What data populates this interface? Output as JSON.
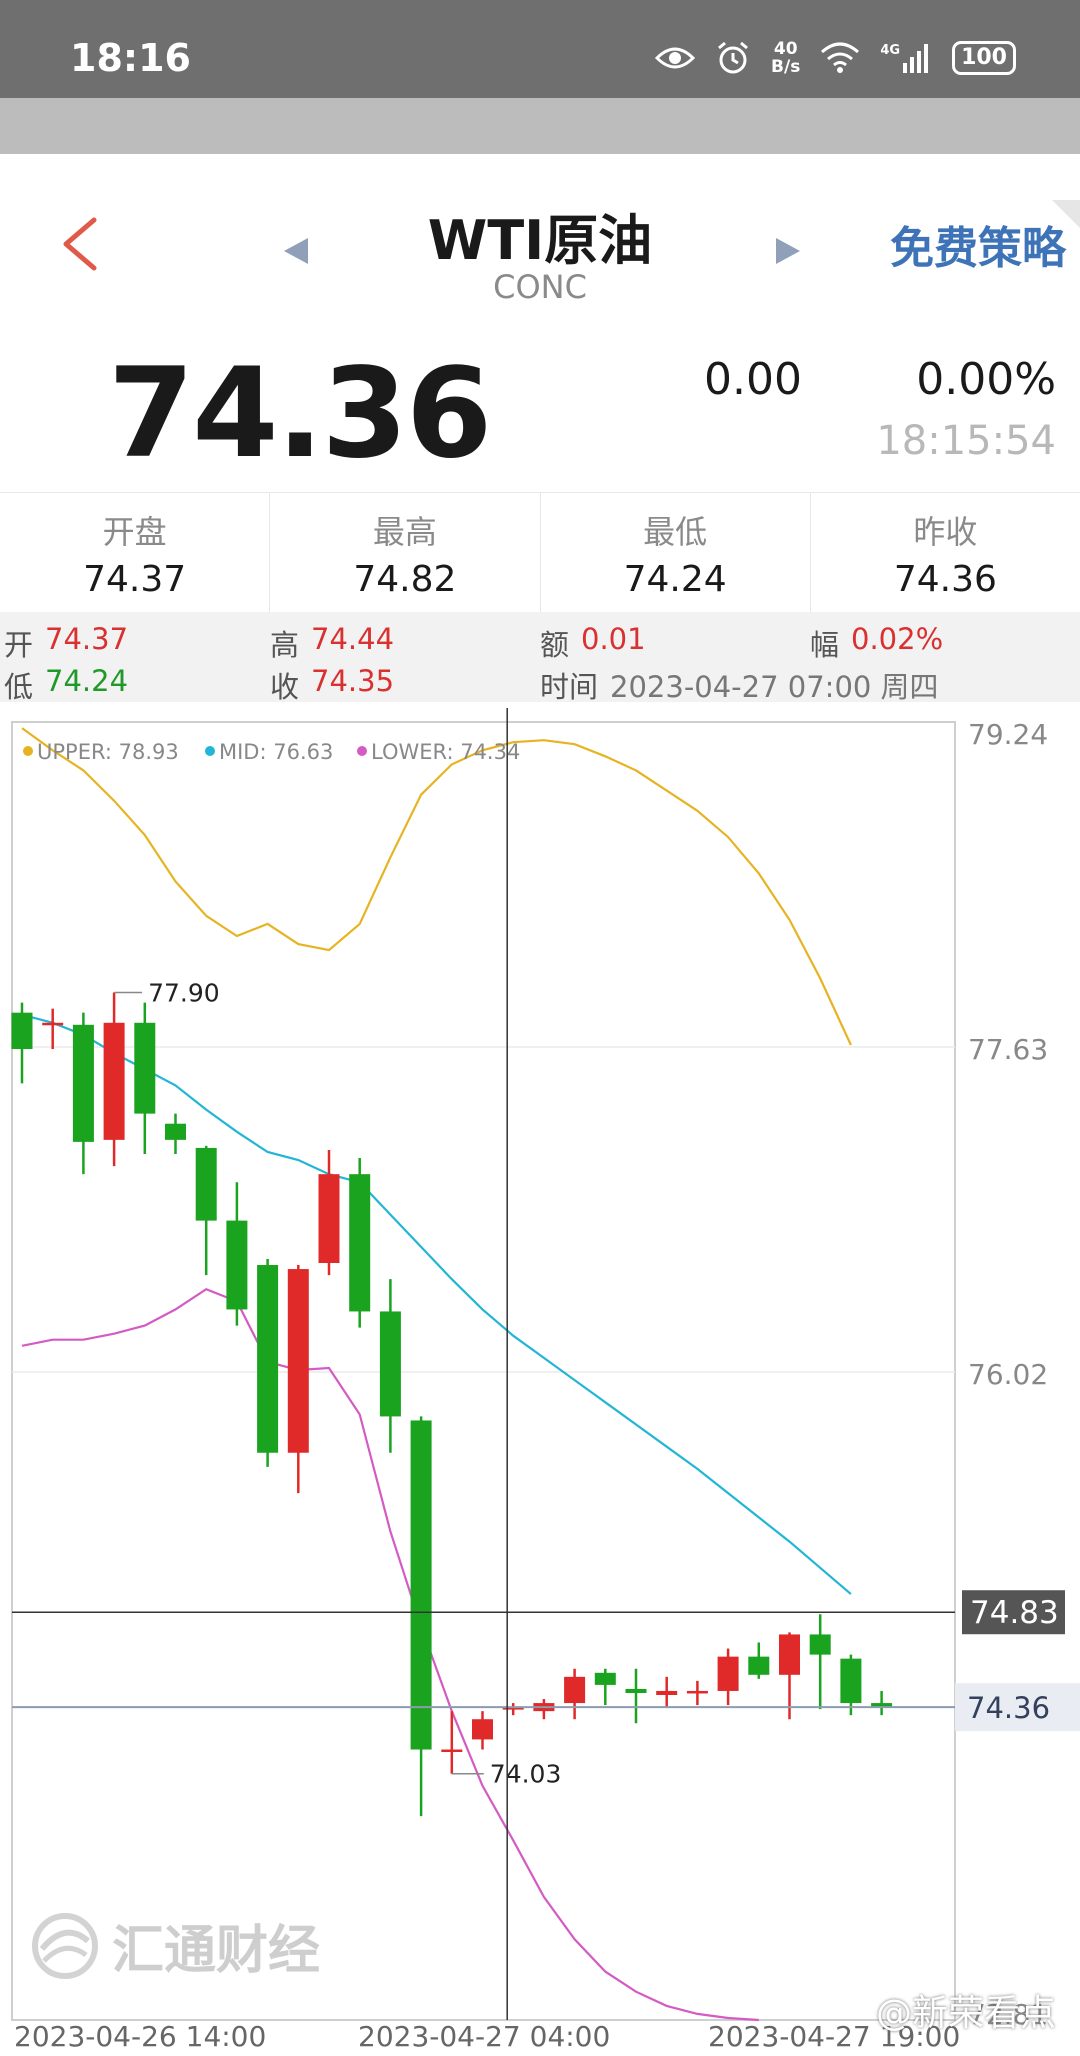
{
  "status_bar": {
    "time": "18:16",
    "net_speed_value": "40",
    "net_speed_unit": "B/s",
    "network": "4G",
    "battery": "100"
  },
  "header": {
    "title": "WTI原油",
    "subtitle": "CONC",
    "strategy_link": "免费策略"
  },
  "quote": {
    "price": "74.36",
    "change": "0.00",
    "change_pct": "0.00%",
    "time": "18:15:54"
  },
  "stats": [
    {
      "label": "开盘",
      "value": "74.37"
    },
    {
      "label": "最高",
      "value": "74.82"
    },
    {
      "label": "最低",
      "value": "74.24"
    },
    {
      "label": "昨收",
      "value": "74.36"
    }
  ],
  "detail": {
    "open_label": "开",
    "open": "74.37",
    "high_label": "高",
    "high": "74.44",
    "amount_label": "额",
    "amount": "0.01",
    "range_label": "幅",
    "range": "0.02%",
    "low_label": "低",
    "low": "74.24",
    "close_label": "收",
    "close": "74.35",
    "time_label": "时间",
    "time": "2023-04-27 07:00 周四"
  },
  "colors": {
    "up": "#e02a2a",
    "down": "#1aa31f",
    "upper": "#e6b422",
    "mid": "#22b5d6",
    "lower": "#d35bc3",
    "strategy": "#3e73b8"
  },
  "chart_data": {
    "type": "candlestick",
    "legend": [
      "UPPER: 78.93",
      "MID: 76.63",
      "LOWER: 74.34"
    ],
    "y_ticks": [
      "79.24",
      "77.63",
      "76.02",
      "72.81"
    ],
    "y_range": [
      72.81,
      79.24
    ],
    "x_ticks": [
      "2023-04-26 14:00",
      "2023-04-27 04:00",
      "2023-04-27 19:00"
    ],
    "crosshair_price": "74.83",
    "crosshair_index": 16,
    "current_price": "74.36",
    "max_label": "77.90",
    "min_label": "74.03",
    "candles": [
      {
        "o": 77.8,
        "h": 77.85,
        "l": 77.45,
        "c": 77.62
      },
      {
        "o": 77.75,
        "h": 77.82,
        "l": 77.62,
        "c": 77.75
      },
      {
        "o": 77.74,
        "h": 77.8,
        "l": 77.0,
        "c": 77.16
      },
      {
        "o": 77.17,
        "h": 77.9,
        "l": 77.04,
        "c": 77.75
      },
      {
        "o": 77.75,
        "h": 77.85,
        "l": 77.1,
        "c": 77.3
      },
      {
        "o": 77.25,
        "h": 77.3,
        "l": 77.1,
        "c": 77.17
      },
      {
        "o": 77.13,
        "h": 77.14,
        "l": 76.5,
        "c": 76.77
      },
      {
        "o": 76.77,
        "h": 76.96,
        "l": 76.25,
        "c": 76.33
      },
      {
        "o": 76.55,
        "h": 76.58,
        "l": 75.55,
        "c": 75.62
      },
      {
        "o": 75.62,
        "h": 76.55,
        "l": 75.42,
        "c": 76.53
      },
      {
        "o": 76.56,
        "h": 77.12,
        "l": 76.5,
        "c": 77.0
      },
      {
        "o": 77.0,
        "h": 77.08,
        "l": 76.24,
        "c": 76.32
      },
      {
        "o": 76.32,
        "h": 76.48,
        "l": 75.62,
        "c": 75.8
      },
      {
        "o": 75.78,
        "h": 75.8,
        "l": 73.82,
        "c": 74.15
      },
      {
        "o": 74.15,
        "h": 74.34,
        "l": 74.03,
        "c": 74.15
      },
      {
        "o": 74.2,
        "h": 74.34,
        "l": 74.15,
        "c": 74.3
      },
      {
        "o": 74.35,
        "h": 74.38,
        "l": 74.32,
        "c": 74.36
      },
      {
        "o": 74.34,
        "h": 74.4,
        "l": 74.3,
        "c": 74.38
      },
      {
        "o": 74.38,
        "h": 74.55,
        "l": 74.3,
        "c": 74.51
      },
      {
        "o": 74.53,
        "h": 74.55,
        "l": 74.37,
        "c": 74.47
      },
      {
        "o": 74.45,
        "h": 74.55,
        "l": 74.28,
        "c": 74.43
      },
      {
        "o": 74.42,
        "h": 74.51,
        "l": 74.36,
        "c": 74.44
      },
      {
        "o": 74.43,
        "h": 74.49,
        "l": 74.37,
        "c": 74.44
      },
      {
        "o": 74.44,
        "h": 74.65,
        "l": 74.37,
        "c": 74.61
      },
      {
        "o": 74.61,
        "h": 74.68,
        "l": 74.5,
        "c": 74.52
      },
      {
        "o": 74.52,
        "h": 74.73,
        "l": 74.3,
        "c": 74.72
      },
      {
        "o": 74.72,
        "h": 74.82,
        "l": 74.35,
        "c": 74.62
      },
      {
        "o": 74.6,
        "h": 74.62,
        "l": 74.32,
        "c": 74.38
      },
      {
        "o": 74.38,
        "h": 74.44,
        "l": 74.32,
        "c": 74.36
      }
    ],
    "upper": [
      79.21,
      79.1,
      79.0,
      78.85,
      78.68,
      78.45,
      78.28,
      78.18,
      78.24,
      78.14,
      78.11,
      78.24,
      78.57,
      78.88,
      79.03,
      79.1,
      79.14,
      79.15,
      79.13,
      79.07,
      79.0,
      78.9,
      78.8,
      78.67,
      78.49,
      78.26,
      77.97,
      77.64
    ],
    "mid": [
      77.79,
      77.75,
      77.69,
      77.6,
      77.52,
      77.44,
      77.32,
      77.21,
      77.11,
      77.07,
      77.0,
      76.96,
      76.8,
      76.64,
      76.48,
      76.33,
      76.2,
      76.09,
      75.98,
      75.87,
      75.76,
      75.65,
      75.54,
      75.42,
      75.3,
      75.18,
      75.05,
      74.92
    ],
    "lower": [
      76.15,
      76.18,
      76.18,
      76.21,
      76.25,
      76.33,
      76.43,
      76.37,
      76.07,
      76.03,
      76.04,
      75.81,
      75.23,
      74.76,
      74.34,
      73.97,
      73.7,
      73.42,
      73.21,
      73.05,
      72.95,
      72.88,
      72.84,
      72.82,
      72.81
    ]
  }
}
